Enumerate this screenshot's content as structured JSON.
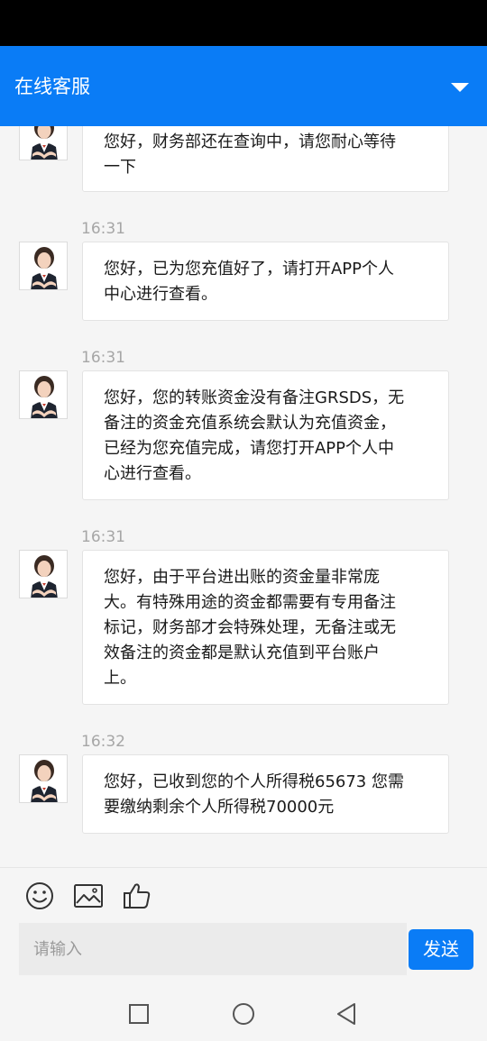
{
  "header": {
    "title": "在线客服",
    "dropdown_icon": "chevron-down-icon"
  },
  "colors": {
    "accent": "#0a7cf6",
    "time_text": "#a6a6a6",
    "bubble_border": "#e3e3e3"
  },
  "messages": [
    {
      "time": "",
      "text": "您好，财务部还在查询中，请您耐心等待\n一下"
    },
    {
      "time": "16:31",
      "text": "您好，已为您充值好了，请打开APP个人\n中心进行查看。"
    },
    {
      "time": "16:31",
      "text": "您好，您的转账资金没有备注GRSDS，无\n备注的资金充值系统会默认为充值资金，\n已经为您充值完成，请您打开APP个人中\n心进行查看。"
    },
    {
      "time": "16:31",
      "text": "您好，由于平台进出账的资金量非常庞\n大。有特殊用途的资金都需要有专用备注\n标记，财务部才会特殊处理，无备注或无\n效备注的资金都是默认充值到平台账户\n上。"
    },
    {
      "time": "16:32",
      "text": "您好，已收到您的个人所得税65673 您需\n要缴纳剩余个人所得税70000元"
    }
  ],
  "toolbar": {
    "icons": [
      "smiley-icon",
      "image-icon",
      "thumbs-up-icon"
    ]
  },
  "composer": {
    "placeholder": "请输入",
    "value": "",
    "send_label": "发送"
  },
  "navigation": {
    "icons": [
      "recent-apps-icon",
      "home-icon",
      "back-icon"
    ]
  }
}
